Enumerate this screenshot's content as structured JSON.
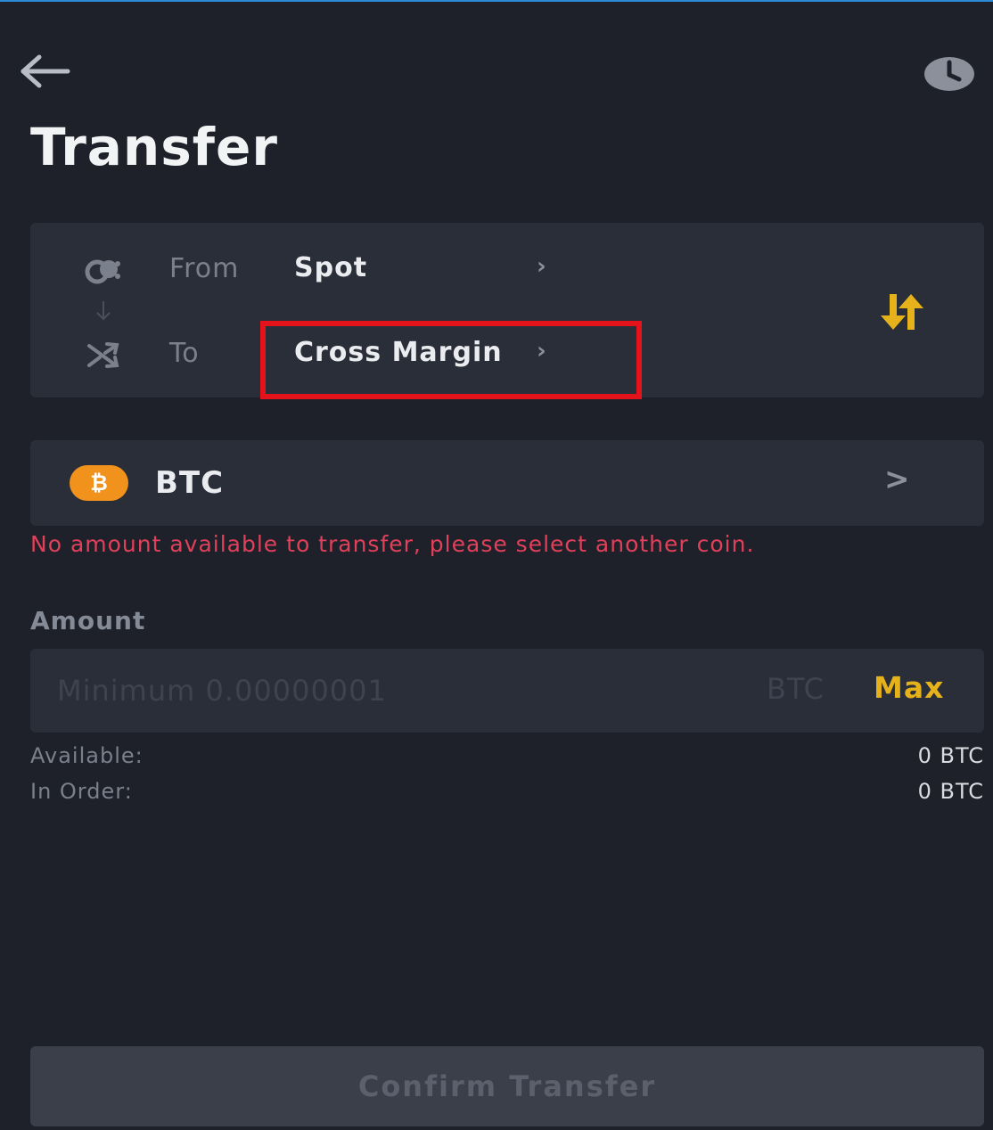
{
  "header": {
    "title": "Transfer",
    "back_icon": "arrow-left-icon",
    "history_icon": "clock-icon"
  },
  "route": {
    "from_label": "From",
    "from_value": "Spot",
    "to_label": "To",
    "to_value": "Cross Margin",
    "chevron": "›",
    "swap_icon": "swap-arrows-icon"
  },
  "coin": {
    "symbol_glyph": "₿",
    "name": "BTC",
    "chevron": ">"
  },
  "error_message": "No amount available to transfer, please select another coin.",
  "amount": {
    "label": "Amount",
    "placeholder": "Minimum 0.00000001",
    "unit": "BTC",
    "max_label": "Max"
  },
  "balances": {
    "available_label": "Available:",
    "available_value": "0 BTC",
    "in_order_label": "In Order:",
    "in_order_value": "0 BTC"
  },
  "confirm_label": "Confirm Transfer",
  "colors": {
    "background": "#1e2129",
    "card": "#2a2e38",
    "accent": "#e6b21c",
    "error": "#e0405a",
    "highlight": "#e4131b",
    "btc": "#f0921c"
  }
}
